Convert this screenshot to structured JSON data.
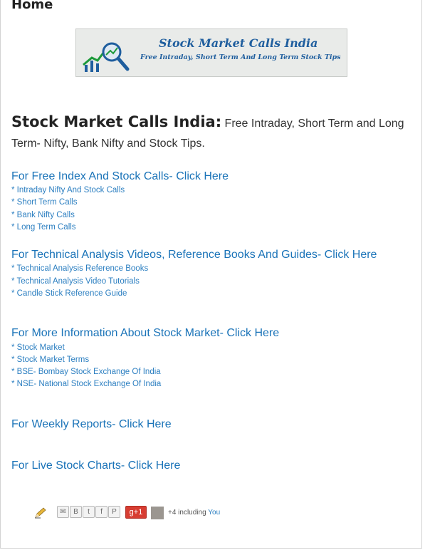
{
  "page": {
    "title": "Home"
  },
  "banner": {
    "title": "Stock Market Calls India",
    "subtitle": "Free Intraday, Short Term And Long Term Stock Tips"
  },
  "intro": {
    "heading": "Stock Market Calls India:",
    "text": " Free Intraday, Short Term and Long Term- Nifty, Bank Nifty and Stock Tips."
  },
  "sections": [
    {
      "heading": "For Free Index And Stock Calls- Click Here",
      "links": [
        "* Intraday Nifty And Stock Calls",
        "* Short Term Calls",
        "* Bank Nifty Calls",
        "* Long Term Calls"
      ]
    },
    {
      "heading": "For Technical Analysis Videos, Reference Books And Guides- Click Here",
      "links": [
        "* Technical Analysis Reference Books",
        "* Technical Analysis Video Tutorials",
        "* Candle Stick Reference Guide"
      ]
    },
    {
      "heading": "For More Information About Stock Market- Click Here",
      "links": [
        "* Stock Market",
        "* Stock Market Terms",
        "* BSE- Bombay Stock Exchange Of India",
        "* NSE- National Stock Exchange Of India"
      ]
    },
    {
      "heading": "For Weekly Reports- Click Here",
      "links": []
    },
    {
      "heading": "For Live Stock Charts- Click Here",
      "links": []
    }
  ],
  "footer": {
    "share_icons": [
      "email-icon",
      "blog-icon",
      "twitter-icon",
      "facebook-icon",
      "pinterest-icon"
    ],
    "gplus_label": "g+1",
    "plus_count": "+4 including ",
    "plus_you": "You"
  },
  "colors": {
    "link": "#2c7fc1",
    "heading_link": "#1a73b8",
    "gplus": "#d73d32"
  }
}
